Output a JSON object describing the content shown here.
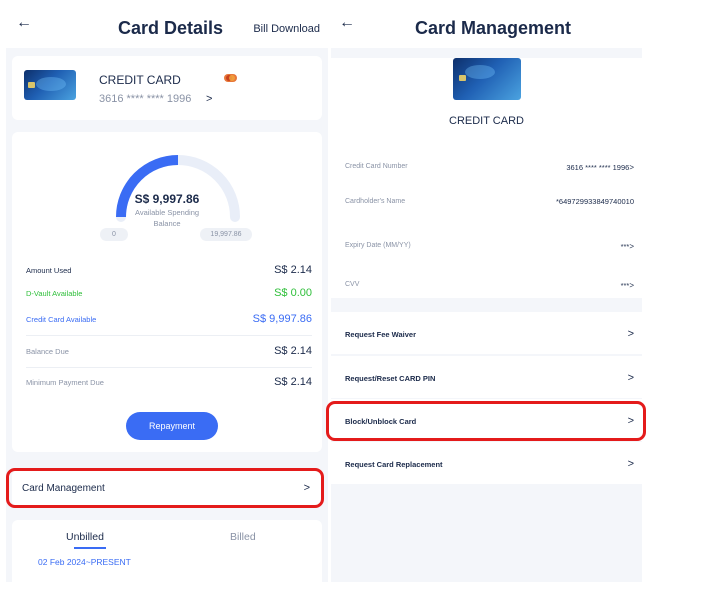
{
  "left": {
    "title": "Card Details",
    "back_icon": "←",
    "bill_download": "Bill Download",
    "card": {
      "name": "CREDIT CARD",
      "number": "3616 **** **** 1996",
      "chevron": ">"
    },
    "gauge": {
      "amount": "S$ 9,997.86",
      "caption_line1": "Available Spending",
      "caption_line2": "Balance",
      "min": "0",
      "max": "19,997.86",
      "fill_fraction": 0.5,
      "fill_color": "#3a6cf4",
      "track_color": "#e9eef8"
    },
    "rows": [
      {
        "label": "Amount Used",
        "value": "S$ 2.14"
      },
      {
        "label": "D-Vault Available",
        "value": "S$ 0.00"
      },
      {
        "label": "Credit Card Available",
        "value": "S$ 9,997.86"
      },
      {
        "label": "Balance Due",
        "value": "S$ 2.14"
      },
      {
        "label": "Minimum Payment Due",
        "value": "S$ 2.14"
      }
    ],
    "repayment_button": "Repayment",
    "card_management": {
      "label": "Card Management",
      "chevron": ">"
    },
    "tabs": {
      "unbilled": "Unbilled",
      "billed": "Billed"
    },
    "period": "02 Feb 2024~PRESENT"
  },
  "right": {
    "title": "Card Management",
    "back_icon": "←",
    "card_name": "CREDIT CARD",
    "info_rows": [
      {
        "label": "Credit Card Number",
        "value": "3616 **** **** 1996",
        "chevron": ">"
      },
      {
        "label": "Cardholder's Name",
        "value": "*649729933849740010",
        "chevron": ""
      },
      {
        "label": "Expiry Date (MM/YY)",
        "value": "***",
        "chevron": ">"
      },
      {
        "label": "CVV",
        "value": "***",
        "chevron": ">"
      }
    ],
    "actions": [
      {
        "label": "Request Fee Waiver",
        "chevron": ">"
      },
      {
        "label": "Request/Reset CARD PIN",
        "chevron": ">"
      },
      {
        "label": "Block/Unblock Card",
        "chevron": ">"
      },
      {
        "label": "Request Card Replacement",
        "chevron": ">"
      }
    ]
  },
  "colors": {
    "accent": "#3a6cf4",
    "green": "#2fbf3a",
    "highlight": "#e41b1b",
    "text": "#1b2a4a"
  }
}
